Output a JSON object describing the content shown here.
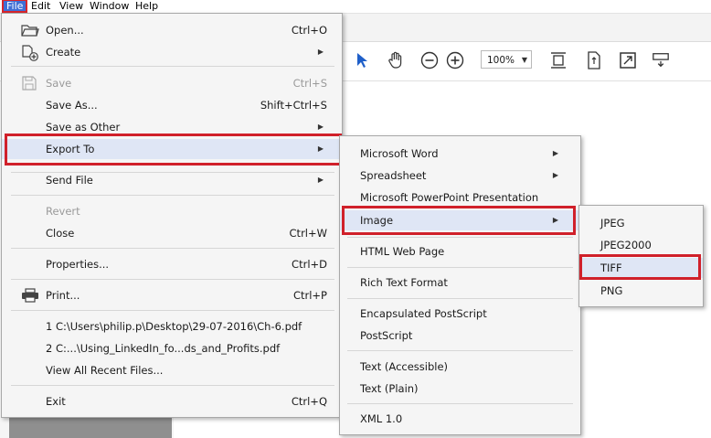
{
  "menubar": {
    "file": "File",
    "edit": "Edit",
    "view": "View",
    "window": "Window",
    "help": "Help"
  },
  "toolbar": {
    "zoom_value": "100%",
    "icons": [
      "select-arrow-icon",
      "hand-tool-icon",
      "zoom-out-icon",
      "zoom-in-icon",
      "fit-page-icon",
      "rotate-page-icon",
      "fullscreen-icon",
      "scroll-mode-icon"
    ]
  },
  "file_menu": {
    "items": {
      "open": {
        "label": "Open...",
        "shortcut": "Ctrl+O"
      },
      "create": {
        "label": "Create"
      },
      "save": {
        "label": "Save",
        "shortcut": "Ctrl+S"
      },
      "save_as": {
        "label": "Save As...",
        "shortcut": "Shift+Ctrl+S"
      },
      "save_as_other": {
        "label": "Save as Other"
      },
      "export_to": {
        "label": "Export To"
      },
      "send_file": {
        "label": "Send File"
      },
      "revert": {
        "label": "Revert"
      },
      "close": {
        "label": "Close",
        "shortcut": "Ctrl+W"
      },
      "properties": {
        "label": "Properties...",
        "shortcut": "Ctrl+D"
      },
      "print": {
        "label": "Print...",
        "shortcut": "Ctrl+P"
      },
      "recent1": {
        "label": "1 C:\\Users\\philip.p\\Desktop\\29-07-2016\\Ch-6.pdf"
      },
      "recent2": {
        "label": "2 C:...\\Using_LinkedIn_fo...ds_and_Profits.pdf"
      },
      "view_all_recent": {
        "label": "View All Recent Files..."
      },
      "exit": {
        "label": "Exit",
        "shortcut": "Ctrl+Q"
      }
    }
  },
  "export_menu": {
    "items": {
      "word": {
        "label": "Microsoft Word"
      },
      "spreadsheet": {
        "label": "Spreadsheet"
      },
      "powerpoint": {
        "label": "Microsoft PowerPoint Presentation"
      },
      "image": {
        "label": "Image"
      },
      "html": {
        "label": "HTML Web Page"
      },
      "rtf": {
        "label": "Rich Text Format"
      },
      "eps": {
        "label": "Encapsulated PostScript"
      },
      "postscript": {
        "label": "PostScript"
      },
      "text_accessible": {
        "label": "Text (Accessible)"
      },
      "text_plain": {
        "label": "Text (Plain)"
      },
      "xml": {
        "label": "XML 1.0"
      }
    }
  },
  "image_menu": {
    "items": {
      "jpeg": {
        "label": "JPEG"
      },
      "jpeg2000": {
        "label": "JPEG2000"
      },
      "tiff": {
        "label": "TIFF"
      },
      "png": {
        "label": "PNG"
      }
    }
  },
  "colors": {
    "highlight": "#dfe6f5",
    "callout_red": "#d0202a",
    "file_selected": "#3f6fd6"
  }
}
